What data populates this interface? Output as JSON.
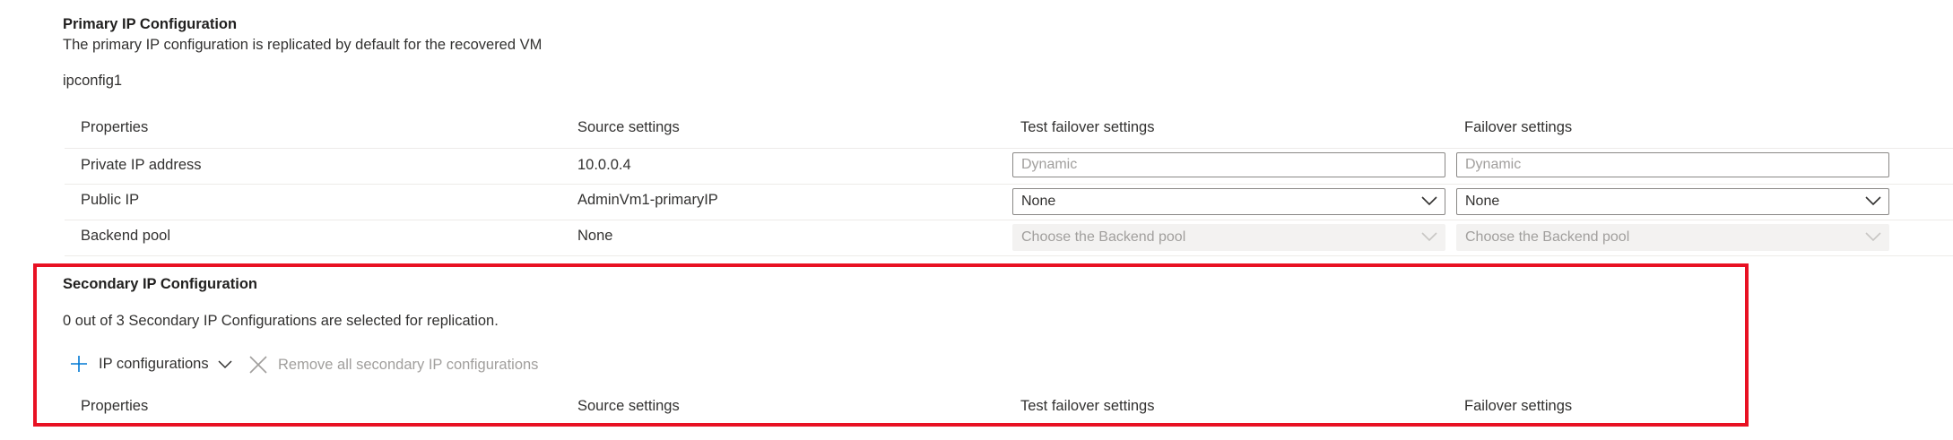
{
  "primary": {
    "title": "Primary IP Configuration",
    "description": "The primary IP configuration is replicated by default for the recovered VM",
    "config_name": "ipconfig1",
    "headers": {
      "properties": "Properties",
      "source": "Source settings",
      "test_failover": "Test failover settings",
      "failover": "Failover settings"
    },
    "rows": [
      {
        "property": "Private IP address",
        "source": "10.0.0.4",
        "test_placeholder": "Dynamic",
        "failover_placeholder": "Dynamic"
      },
      {
        "property": "Public IP",
        "source": "AdminVm1-primaryIP",
        "test_value": "None",
        "failover_value": "None"
      },
      {
        "property": "Backend pool",
        "source": "None",
        "test_placeholder": "Choose the Backend pool",
        "failover_placeholder": "Choose the Backend pool"
      }
    ]
  },
  "secondary": {
    "title": "Secondary IP Configuration",
    "status": "0 out of 3 Secondary IP Configurations are selected for replication.",
    "ip_config_button": "IP configurations",
    "remove_button": "Remove all secondary IP configurations",
    "headers": {
      "properties": "Properties",
      "source": "Source settings",
      "test_failover": "Test failover settings",
      "failover": "Failover settings"
    }
  },
  "colors": {
    "highlight": "#e81123",
    "accent": "#0078d4"
  },
  "icons": [
    "plus-icon",
    "chevron-down-icon",
    "close-icon"
  ]
}
